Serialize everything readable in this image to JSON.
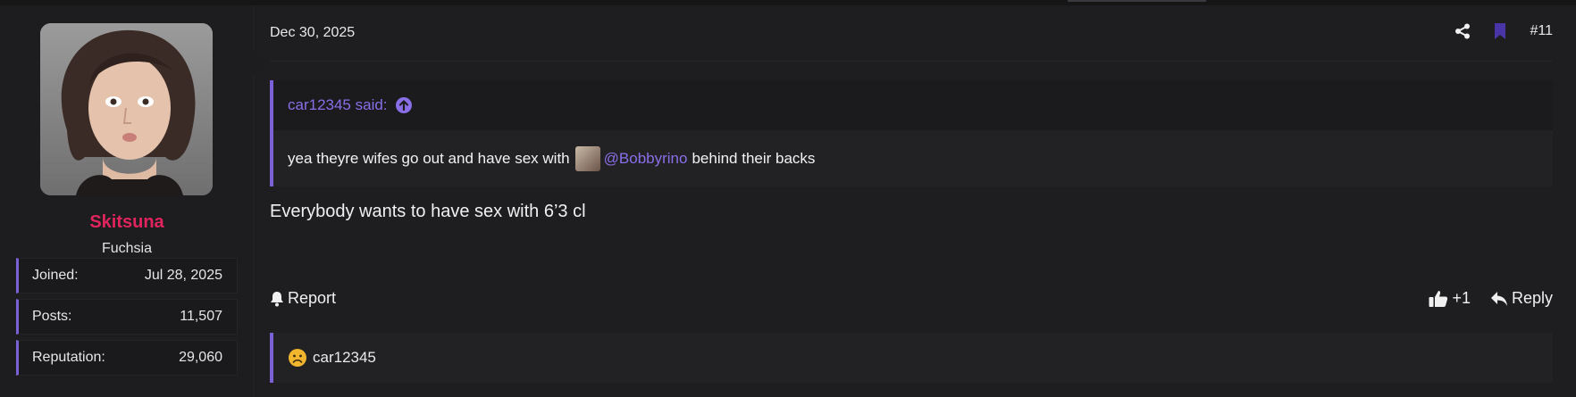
{
  "post": {
    "date": "Dec 30, 2025",
    "number": "#11",
    "quote": {
      "author_label": "car12345 said:",
      "text_before": "yea theyre wifes go out and have sex with",
      "mention": "@Bobbyrino",
      "text_after": "behind their backs"
    },
    "message": "Everybody wants to have sex with 6’3 cl",
    "actions": {
      "report_label": "Report",
      "like_label": "+1",
      "reply_label": "Reply"
    },
    "reactions": {
      "user": "car12345"
    }
  },
  "user": {
    "name": "Skitsuna",
    "title": "Fuchsia",
    "stats": [
      {
        "label": "Joined:",
        "value": "Jul 28, 2025"
      },
      {
        "label": "Posts:",
        "value": "11,507"
      },
      {
        "label": "Reputation:",
        "value": "29,060"
      }
    ]
  },
  "colors": {
    "accent": "#7b61d6",
    "username": "#e0245e",
    "link": "#8a6ee8",
    "background": "#1e1e20"
  },
  "icons": [
    "share-icon",
    "bookmark-icon",
    "arrow-up-circle-icon",
    "bell-icon",
    "thumbs-up-icon",
    "reply-icon",
    "sad-face-icon"
  ]
}
